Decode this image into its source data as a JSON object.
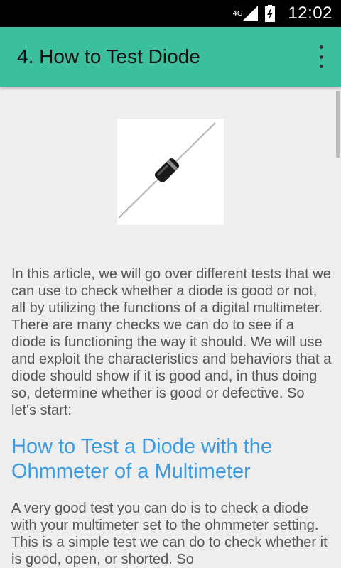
{
  "status_bar": {
    "network": "4G",
    "time": "12:02"
  },
  "app_bar": {
    "title": "4. How to Test Diode",
    "menu_icon": "overflow-menu-icon"
  },
  "article": {
    "image_icon": "diode-image",
    "paragraph_1": "In this article, we will go over different tests that we can use to check whether a diode is good or not, all by utilizing the functions of a digital multimeter.  There are many checks we can do to see if a diode is functioning the way it should. We will use and exploit the characteristics and behaviors that a diode should show if it is good and, in thus doing so, determine whether is good or defective.  So let's start:",
    "heading_1": "How to Test a Diode with the Ohmmeter of a Multimeter",
    "paragraph_2": "A very good test you can do is to check a diode with your multimeter set to the ohmmeter setting.  This is a simple test we can do to check whether it is good, open, or shorted.  So"
  },
  "colors": {
    "app_bar": "#3cbf9c",
    "heading": "#3d9be0",
    "background": "#eeeeee"
  }
}
